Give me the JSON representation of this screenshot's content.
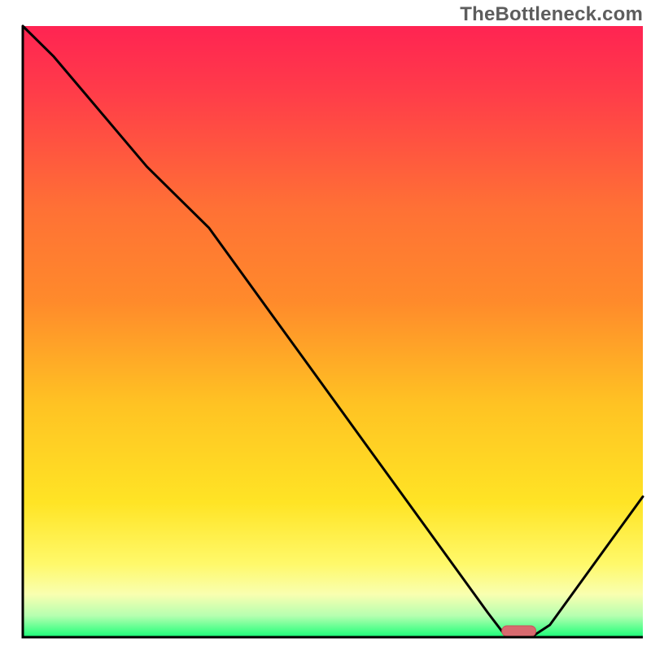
{
  "watermark": "TheBottleneck.com",
  "chart_data": {
    "type": "line",
    "title": "",
    "xlabel": "",
    "ylabel": "",
    "xlim": [
      0,
      100
    ],
    "ylim": [
      0,
      100
    ],
    "x": [
      0,
      5,
      10,
      15,
      20,
      25,
      30,
      35,
      40,
      45,
      50,
      55,
      60,
      65,
      70,
      75,
      78,
      82,
      85,
      90,
      95,
      100
    ],
    "values": [
      100,
      95,
      89,
      83,
      77,
      72,
      67,
      60,
      53,
      46,
      39,
      32,
      25,
      18,
      11,
      4,
      0,
      0,
      2,
      9,
      16,
      23
    ],
    "colors": {
      "gradient_top": "#ff2452",
      "gradient_mid_upper": "#ff8a2b",
      "gradient_mid_lower": "#ffe425",
      "gradient_lower": "#f9ffb0",
      "gradient_bottom": "#19ff78",
      "curve": "#000000",
      "marker_fill": "#d86a6f",
      "marker_stroke": "#c7545a",
      "axis": "#000000"
    },
    "marker": {
      "x_fraction": 0.8,
      "width_fraction": 0.055
    }
  }
}
